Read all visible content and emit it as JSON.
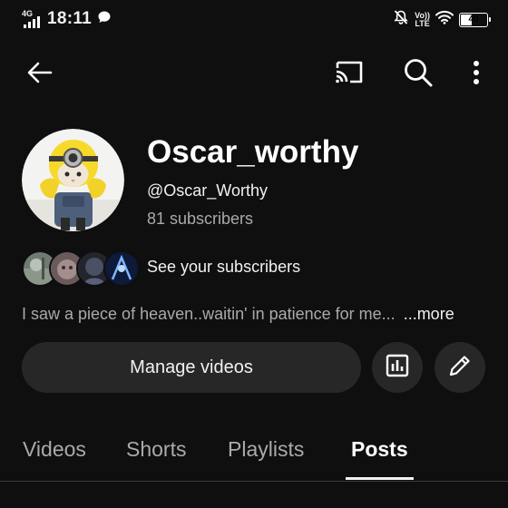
{
  "status_bar": {
    "network_label": "4G",
    "time": "18:11",
    "volte_top": "Vo))",
    "volte_bottom": "LTE",
    "battery_level": "40"
  },
  "top_bar": {
    "back_icon": "arrow-left-icon",
    "cast_icon": "cast-icon",
    "search_icon": "search-icon",
    "more_icon": "more-vertical-icon"
  },
  "channel": {
    "name": "Oscar_worthy",
    "handle": "@Oscar_Worthy",
    "subscribers": "81 subscribers",
    "see_subscribers": "See your subscribers",
    "description": "I saw a piece of heaven..waitin' in patience for me...",
    "more_label": "...more"
  },
  "actions": {
    "manage_videos": "Manage videos",
    "analytics_icon": "analytics-icon",
    "edit_icon": "edit-pencil-icon"
  },
  "tabs": [
    {
      "label": "Videos",
      "active": false
    },
    {
      "label": "Shorts",
      "active": false
    },
    {
      "label": "Playlists",
      "active": false
    },
    {
      "label": "Posts",
      "active": true
    }
  ],
  "colors": {
    "background": "#0f0f0f",
    "surface": "#272727",
    "text_primary": "#f1f1f1",
    "text_secondary": "#aaaaaa"
  }
}
